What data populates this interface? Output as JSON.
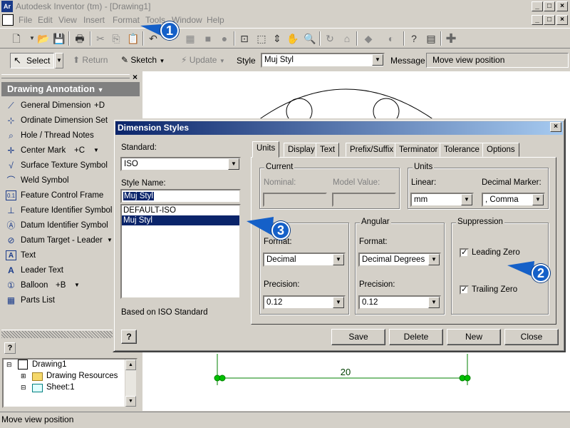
{
  "window": {
    "title": "Autodesk Inventor (tm) - [Drawing1]",
    "app_icon": "Ar"
  },
  "menu": [
    "File",
    "Edit",
    "View",
    "Insert",
    "Format",
    "Tools",
    "Window",
    "Help"
  ],
  "toolbar2": {
    "select_label": "Select",
    "return_label": "Return",
    "sketch_label": "Sketch",
    "update_label": "Update",
    "style_label": "Style",
    "style_value": "Muj Styl",
    "message_label": "Message",
    "message_value": "Move view position"
  },
  "panel": {
    "header": "Drawing Annotation",
    "tools": [
      {
        "label": "General Dimension",
        "shortcut": "+D",
        "icon": "dimension-icon"
      },
      {
        "label": "Ordinate Dimension Set",
        "shortcut": "",
        "icon": "ordinate-icon"
      },
      {
        "label": "Hole / Thread Notes",
        "shortcut": "",
        "icon": "hole-note-icon"
      },
      {
        "label": "Center Mark",
        "shortcut": "+C",
        "icon": "center-mark-icon"
      },
      {
        "label": "Surface Texture Symbol",
        "shortcut": "",
        "icon": "surface-texture-icon"
      },
      {
        "label": "Weld Symbol",
        "shortcut": "",
        "icon": "weld-icon"
      },
      {
        "label": "Feature Control Frame",
        "shortcut": "",
        "icon": "feature-frame-icon"
      },
      {
        "label": "Feature Identifier Symbol",
        "shortcut": "",
        "icon": "feature-id-icon"
      },
      {
        "label": "Datum Identifier Symbol",
        "shortcut": "",
        "icon": "datum-id-icon"
      },
      {
        "label": "Datum Target - Leader",
        "shortcut": "",
        "icon": "datum-target-icon"
      },
      {
        "label": "Text",
        "shortcut": "",
        "icon": "text-icon"
      },
      {
        "label": "Leader Text",
        "shortcut": "",
        "icon": "leader-text-icon"
      },
      {
        "label": "Balloon",
        "shortcut": "+B",
        "icon": "balloon-icon"
      },
      {
        "label": "Parts List",
        "shortcut": "",
        "icon": "parts-list-icon"
      }
    ]
  },
  "browser": {
    "items": [
      "Drawing1",
      "Drawing Resources",
      "Sheet:1"
    ]
  },
  "drawing": {
    "dimension_value": "20"
  },
  "status": "Move view position",
  "dialog": {
    "title": "Dimension Styles",
    "standard_label": "Standard:",
    "standard_value": "ISO",
    "style_name_label": "Style Name:",
    "style_name_value": "Muj Styl",
    "styles": [
      "DEFAULT-ISO",
      "Muj Styl"
    ],
    "selected_style": "Muj Styl",
    "based_on": "Based on ISO Standard",
    "tabs": [
      "Units",
      "Display",
      "Text",
      "Prefix/Suffix",
      "Terminator",
      "Tolerance",
      "Options"
    ],
    "active_tab": "Units",
    "current": {
      "group": "Current",
      "nominal_label": "Nominal:",
      "model_label": "Model Value:"
    },
    "units": {
      "group": "Units",
      "linear_label": "Linear:",
      "linear_value": "mm",
      "decimal_label": "Decimal Marker:",
      "decimal_value": ", Comma"
    },
    "linear": {
      "format_label": "Format:",
      "format_value": "Decimal",
      "precision_label": "Precision:",
      "precision_value": "0.12"
    },
    "angular": {
      "group": "Angular",
      "format_label": "Format:",
      "format_value": "Decimal Degrees",
      "precision_label": "Precision:",
      "precision_value": "0.12"
    },
    "suppression": {
      "group": "Suppression",
      "leading_zero": "Leading Zero",
      "trailing_zero": "Trailing Zero"
    },
    "buttons": {
      "save": "Save",
      "delete": "Delete",
      "new": "New",
      "close": "Close"
    }
  },
  "callouts": [
    "1",
    "2",
    "3"
  ],
  "colors": {
    "title_active": "#0a246a",
    "callout": "#1560c8",
    "dimension": "#008000"
  }
}
